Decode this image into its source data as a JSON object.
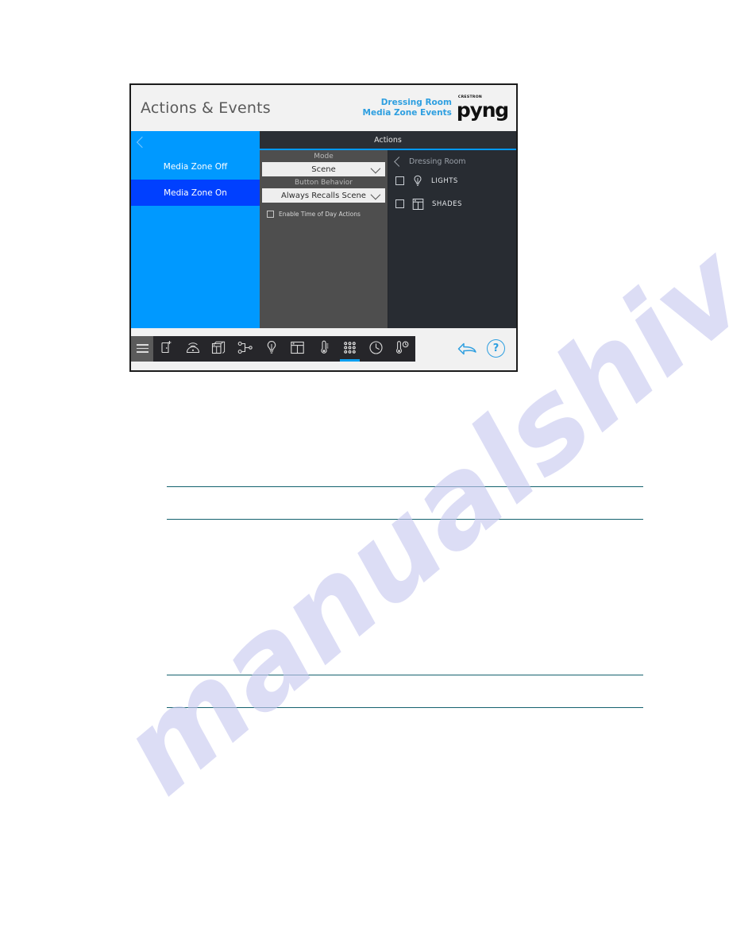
{
  "device": {
    "title_bar": {
      "app_title": "Actions & Events",
      "context_line_1": "Dressing Room",
      "context_line_2": "Media Zone Events",
      "brand_sub": "CRESTRON",
      "brand_name": "pyng"
    },
    "left_panel": {
      "back_icon": "chevron-left-icon",
      "items": [
        {
          "label": "Media Zone Off",
          "selected": false
        },
        {
          "label": "Media Zone On",
          "selected": true
        }
      ]
    },
    "actions_tab": {
      "label": "Actions"
    },
    "settings_pane": {
      "mode_label": "Mode",
      "mode_value": "Scene",
      "button_behavior_label": "Button Behavior",
      "button_behavior_value": "Always Recalls Scene",
      "time_of_day_label": "Enable Time of Day Actions",
      "time_of_day_checked": false
    },
    "rooms_pane": {
      "back_icon": "chevron-left-icon",
      "room_name": "Dressing Room",
      "loads": [
        {
          "label": "LIGHTS",
          "icon": "lightbulb-icon",
          "checked": false
        },
        {
          "label": "SHADES",
          "icon": "shades-icon",
          "checked": false
        }
      ]
    },
    "toolbar": {
      "menu_icon": "hamburger-menu-icon",
      "tools": [
        {
          "icon": "room-add-icon",
          "active": false
        },
        {
          "icon": "wireless-gateway-icon",
          "active": false
        },
        {
          "icon": "shades-stack-icon",
          "active": false
        },
        {
          "icon": "network-nodes-icon",
          "active": false
        },
        {
          "icon": "lightbulb-icon",
          "active": false
        },
        {
          "icon": "window-shades-icon",
          "active": false
        },
        {
          "icon": "thermostat-icon",
          "active": false
        },
        {
          "icon": "keypad-icon",
          "active": true
        },
        {
          "icon": "clock-icon",
          "active": false
        },
        {
          "icon": "thermostat-schedule-icon",
          "active": false
        }
      ],
      "undo_icon": "undo-arrow-icon",
      "help_icon": "help-question-icon",
      "help_label": "?"
    },
    "colors": {
      "accent_blue": "#0099ff",
      "selected_blue": "#0040ff",
      "panel_grey": "#4e4e4e",
      "panel_dark": "#282c32",
      "tab_dark": "#2b2f35",
      "link_blue": "#2e9fe0"
    }
  },
  "page": {
    "watermark": "manualshive.com",
    "rule_count": 4
  }
}
